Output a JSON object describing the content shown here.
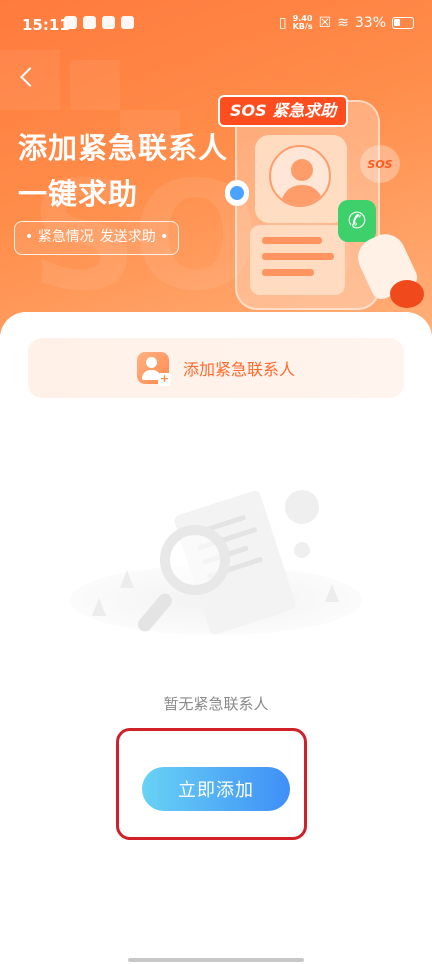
{
  "status_bar": {
    "time": "15:11",
    "net_speed_top": "9.40",
    "net_speed_bottom": "KB/s",
    "battery": "33%"
  },
  "hero": {
    "title_line1": "添加紧急联系人",
    "title_line2": "一键求助",
    "tag_text1": "• 紧急情况",
    "tag_text2": "发送求助 •",
    "sos_banner": "SOS 紧急求助",
    "sos_badge": "SOS",
    "bg_watermark": "SOS"
  },
  "add_contact": {
    "label": "添加紧急联系人"
  },
  "empty_state": {
    "message": "暂无紧急联系人",
    "button_label": "立即添加"
  },
  "colors": {
    "hero_orange": "#ff7a3d",
    "accent_orange": "#ff6a2d",
    "button_blue_start": "#68d2f5",
    "button_blue_end": "#3f8ff7",
    "highlight_red": "#d0202a"
  }
}
